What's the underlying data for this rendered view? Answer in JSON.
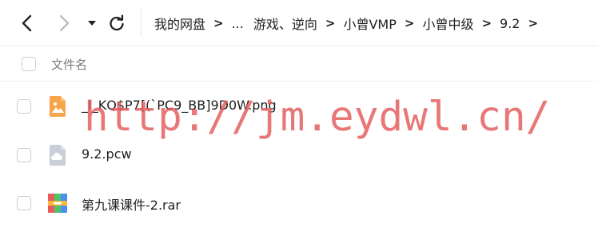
{
  "toolbar": {
    "back_icon": "chevron-left-icon",
    "forward_icon": "chevron-right-icon",
    "dropdown_icon": "caret-down-icon",
    "refresh_icon": "refresh-icon"
  },
  "breadcrumb": {
    "items": [
      "我的网盘",
      "...",
      "游戏、逆向",
      "小曾VMP",
      "小曾中级",
      "9.2"
    ],
    "separator": ">"
  },
  "list": {
    "header_label": "文件名",
    "files": [
      {
        "name": "_I_KQ$P7[(`PC9_BB]9D0W.png",
        "icon": "image-file-icon"
      },
      {
        "name": "9.2.pcw",
        "icon": "cloud-file-icon"
      },
      {
        "name": "第九课课件-2.rar",
        "icon": "archive-file-icon"
      }
    ]
  },
  "watermark": "http://jm.eydwl.cn/",
  "colors": {
    "image_icon": "#f7a44c",
    "cloud_icon": "#c8cfd8",
    "watermark": "#e35a5a"
  }
}
